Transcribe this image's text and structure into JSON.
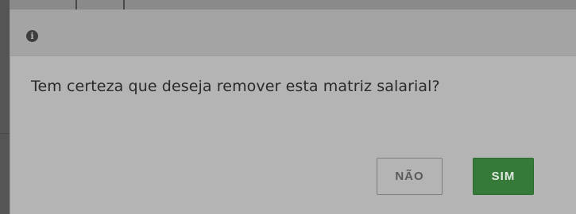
{
  "dialog": {
    "icon": "info-icon",
    "icon_glyph": "i",
    "message": "Tem certeza que deseja remover esta matriz salarial?",
    "buttons": {
      "no_label": "NÃO",
      "yes_label": "SIM"
    }
  },
  "colors": {
    "confirm_button": "#357a39",
    "dialog_background": "#b4b4b4",
    "header_background": "#a4a4a4"
  }
}
